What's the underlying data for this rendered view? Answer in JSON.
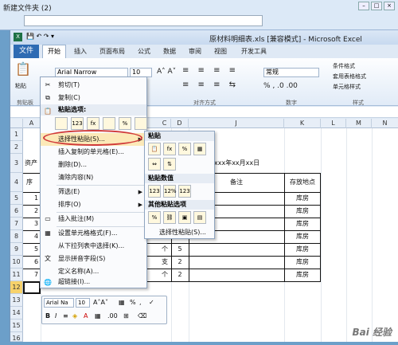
{
  "explorer": {
    "title": "新建文件夹 (2)"
  },
  "excel": {
    "title": "原材料明细表.xls [兼容模式] - Microsoft Excel",
    "tabs": [
      "开始",
      "插入",
      "页面布局",
      "公式",
      "数据",
      "审阅",
      "视图",
      "开发工具"
    ],
    "file_tab": "文件",
    "font_name": "Arial Narrow",
    "font_size": "10",
    "number_format": "常规",
    "groups": {
      "clipboard": "剪贴板",
      "alignment": "对齐方式",
      "number": "数字",
      "styles": "样式"
    },
    "style_buttons": [
      "条件格式",
      "套用表格格式",
      "单元格样式"
    ],
    "paste_label": "粘贴"
  },
  "grid": {
    "columns": [
      "A",
      "B",
      "C",
      "D",
      "E",
      "F",
      "G",
      "H",
      "I",
      "J",
      "K",
      "L",
      "M",
      "N"
    ],
    "rows": [
      "1",
      "2",
      "3",
      "4",
      "5",
      "6",
      "7",
      "8",
      "9",
      "10",
      "11",
      "12",
      "13",
      "14",
      "15",
      "16"
    ],
    "fragments": {
      "r3a": "资产",
      "r3j": "xxx年xx月xx日",
      "r4a": "序",
      "r4j": "备注",
      "r4k": "存放地点"
    },
    "row_nums": [
      "1",
      "2",
      "3",
      "4",
      "5",
      "6",
      "7"
    ],
    "units": [
      "个",
      "支",
      "个"
    ],
    "qty": [
      "5",
      "2",
      "2"
    ],
    "storage": [
      "库房",
      "库房",
      "库房",
      "库房",
      "库房",
      "库房",
      "库房"
    ],
    "row4_unit": "支",
    "row8_char": "Φ"
  },
  "context_menu": {
    "items": [
      "剪切(T)",
      "复制(C)",
      "粘贴选项:",
      "选择性粘贴(S)...",
      "插入复制的单元格(E)...",
      "删除(D)...",
      "清除内容(N)",
      "筛选(E)",
      "排序(O)",
      "插入批注(M)",
      "设置单元格格式(F)...",
      "从下拉列表中选择(K)...",
      "显示拼音字段(S)",
      "定义名称(A)...",
      "超链接(I)..."
    ],
    "paste_icons": [
      "",
      "123",
      "fx",
      "",
      "%",
      ""
    ]
  },
  "submenu": {
    "headers": [
      "粘贴",
      "粘贴数值",
      "其他粘贴选项"
    ],
    "footer": "选择性粘贴(S)..."
  },
  "mini_toolbar": {
    "font": "Arial Na",
    "size": "10",
    "percent": "%",
    "comma": ","
  },
  "watermark": "Bai 经验"
}
